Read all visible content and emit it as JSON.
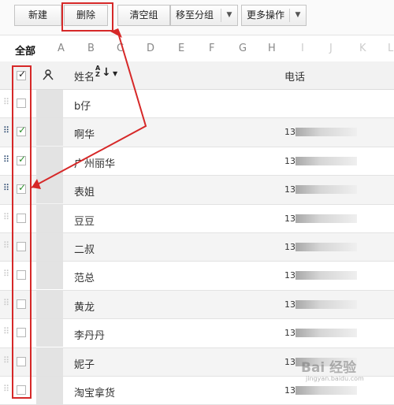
{
  "toolbar": {
    "new_label": "新建",
    "delete_label": "删除",
    "clear_group_label": "清空组",
    "move_group_label": "移至分组",
    "more_ops_label": "更多操作",
    "dropdown_glyph": "▼"
  },
  "alphabet": {
    "all_label": "全部",
    "letters": [
      "A",
      "B",
      "C",
      "D",
      "E",
      "F",
      "G",
      "H",
      "I",
      "J",
      "K",
      "L"
    ]
  },
  "table": {
    "name_header": "姓名",
    "sort_glyph": "↓",
    "sort_letters": "AZ",
    "phone_header": "电话",
    "rows": [
      {
        "name": "b仔",
        "phone_prefix": "",
        "checked": false,
        "drag_active": false
      },
      {
        "name": "啊华",
        "phone_prefix": "13",
        "checked": true,
        "drag_active": true
      },
      {
        "name": "广州丽华",
        "phone_prefix": "13",
        "checked": true,
        "drag_active": true
      },
      {
        "name": "表姐",
        "phone_prefix": "13",
        "checked": true,
        "drag_active": true
      },
      {
        "name": "豆豆",
        "phone_prefix": "13",
        "checked": false,
        "drag_active": false
      },
      {
        "name": "二叔",
        "phone_prefix": "13",
        "checked": false,
        "drag_active": false
      },
      {
        "name": "范总",
        "phone_prefix": "13",
        "checked": false,
        "drag_active": false
      },
      {
        "name": "黄龙",
        "phone_prefix": "13",
        "checked": false,
        "drag_active": false
      },
      {
        "name": "李丹丹",
        "phone_prefix": "13",
        "checked": false,
        "drag_active": false
      },
      {
        "name": "妮子",
        "phone_prefix": "13",
        "checked": false,
        "drag_active": false
      },
      {
        "name": "淘宝拿货",
        "phone_prefix": "13",
        "checked": false,
        "drag_active": false
      }
    ]
  },
  "watermark": {
    "text": "Bai 经验",
    "sub": "jingyan.baidu.com"
  },
  "colors": {
    "annotation_red": "#d62828",
    "check_green": "#2a8f2a"
  }
}
